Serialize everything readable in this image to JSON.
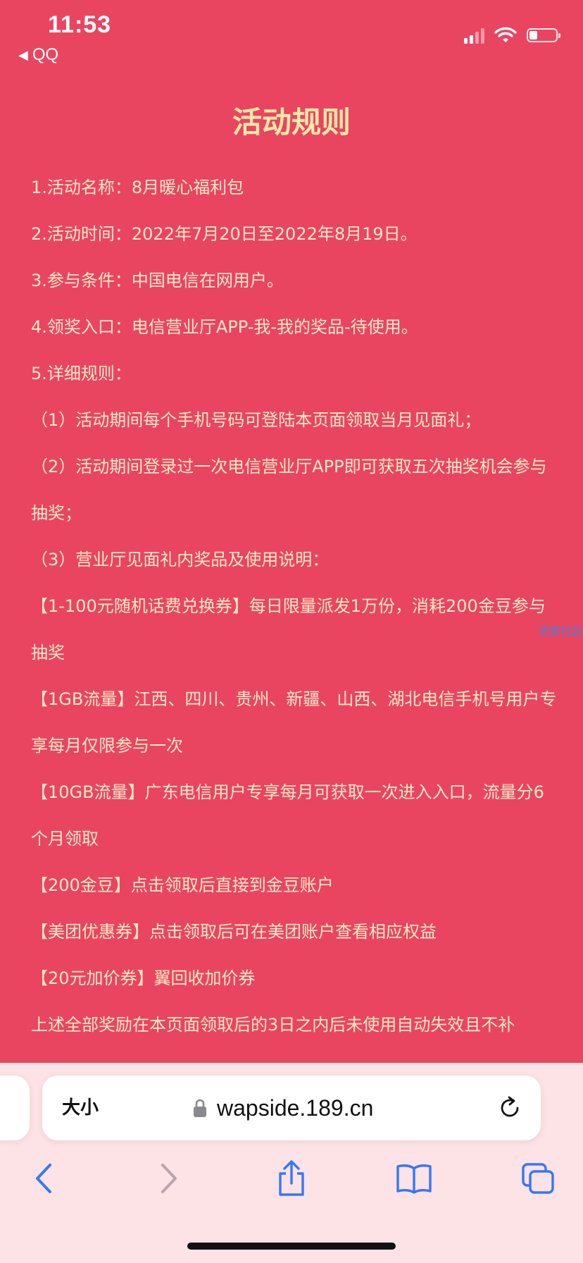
{
  "status": {
    "time": "11:53",
    "back_app": "QQ",
    "battery_level": 0.3
  },
  "page": {
    "title": "活动规则",
    "rules": [
      "1.活动名称：8月暖心福利包",
      "2.活动时间：2022年7月20日至2022年8月19日。",
      "3.参与条件：中国电信在网用户。",
      "4.领奖入口：电信营业厅APP-我-我的奖品-待使用。",
      "5.详细规则：",
      "（1）活动期间每个手机号码可登陆本页面领取当月见面礼；",
      "（2）活动期间登录过一次电信营业厅APP即可获取五次抽奖机会参与抽奖；",
      "（3）营业厅见面礼内奖品及使用说明：",
      "【1-100元随机话费兑换券】每日限量派发1万份，消耗200金豆参与抽奖",
      "【1GB流量】江西、四川、贵州、新疆、山西、湖北电信手机号用户专享每月仅限参与一次",
      "【10GB流量】广东电信用户专享每月可获取一次进入入口，流量分6个月领取",
      "【200金豆】点击领取后直接到金豆账户",
      "【美团优惠券】点击领取后可在美团账户查看相应权益",
      "【20元加价券】翼回收加价券",
      "上述全部奖励在本页面领取后的3日之内后未使用自动失效且不补"
    ],
    "watermark": "浓厚社区"
  },
  "browser": {
    "text_size_label": "大小",
    "url": "wapside.189.cn"
  },
  "colors": {
    "background": "#e94560",
    "title": "#ffe9a8",
    "body_text": "#ffe9c8",
    "accent": "#3478f6"
  }
}
